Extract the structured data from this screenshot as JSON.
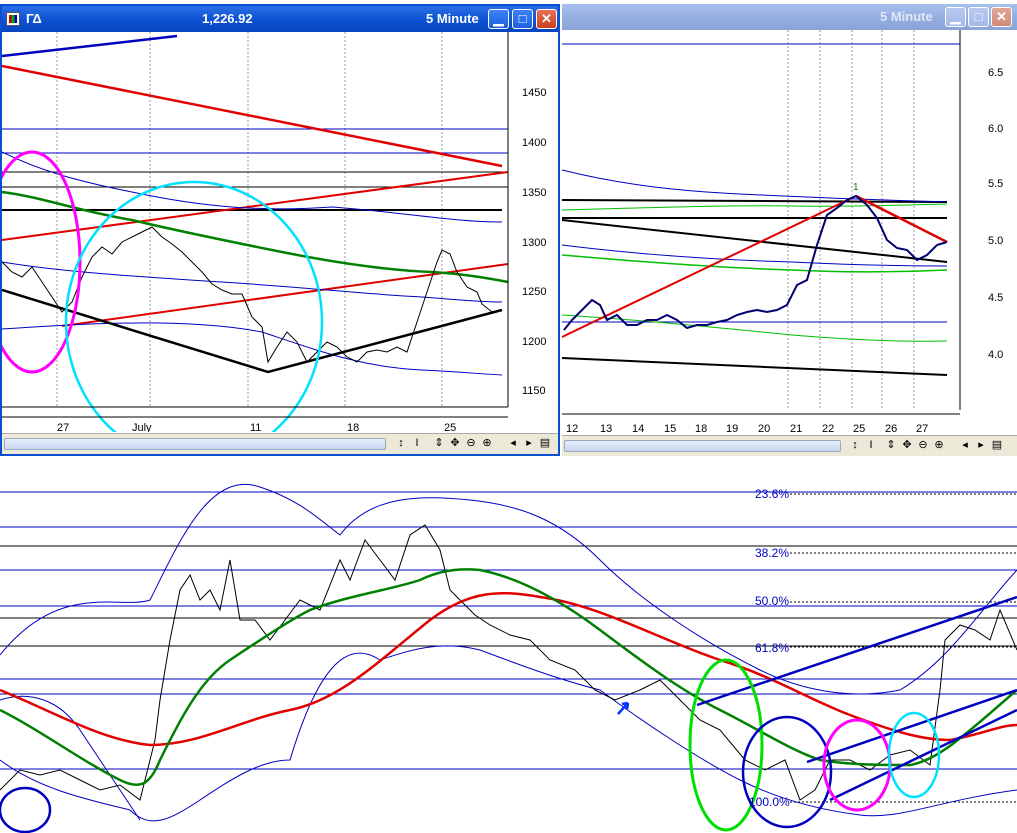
{
  "window_left": {
    "title": "ΓΔ",
    "price": "1,226.92",
    "interval": "5 Minute",
    "price_ticks": [
      "1450",
      "1400",
      "1350",
      "1300",
      "1250",
      "1200",
      "1150"
    ],
    "date_ticks": [
      "27",
      "July",
      "11",
      "18",
      "25"
    ]
  },
  "window_right": {
    "interval": "5 Minute",
    "price_ticks": [
      "6.5",
      "6.0",
      "5.5",
      "5.0",
      "4.5",
      "4.0"
    ],
    "date_ticks": [
      "12",
      "13",
      "14",
      "15",
      "18",
      "19",
      "20",
      "21",
      "22",
      "25",
      "26",
      "27"
    ],
    "wave_label": "1"
  },
  "bottom_chart": {
    "fib_levels": [
      "23.6%",
      "38.2%",
      "50.0%",
      "61.8%",
      "100.0%"
    ]
  },
  "toolbar_icons": [
    "cursor-icon",
    "text-tool-icon",
    "vertical-resize-icon",
    "pan-icon",
    "zoom-out-icon",
    "zoom-in-icon",
    "scroll-left-icon",
    "scroll-right-icon",
    "menu-icon"
  ],
  "colors": {
    "titlebar_active": "#0a4fd0",
    "titlebar_inactive": "#93acdf",
    "trend_red": "#e00000",
    "moving_avg_green": "#008000",
    "band_blue": "#0000c0",
    "circle_magenta": "#ff00ff",
    "circle_cyan": "#00e0ff",
    "circle_green": "#00e000"
  }
}
